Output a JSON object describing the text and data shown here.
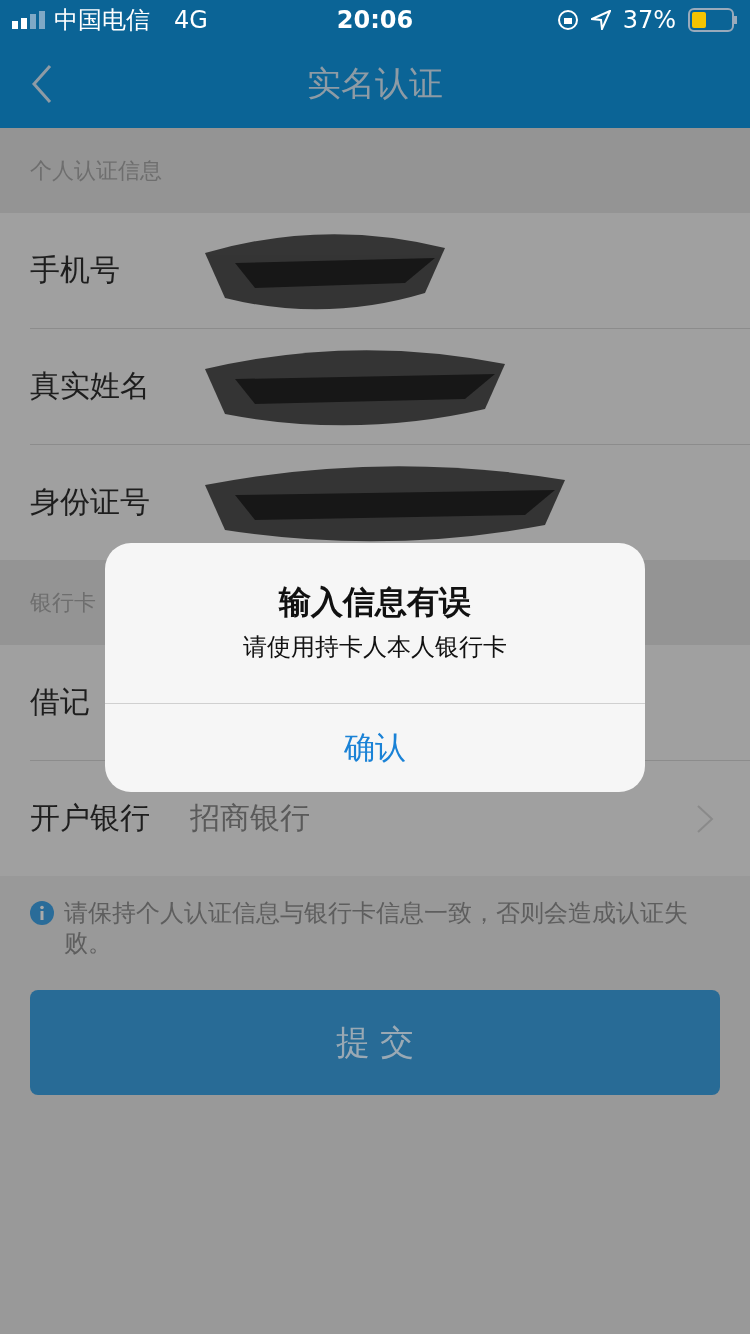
{
  "status_bar": {
    "carrier": "中国电信",
    "network": "4G",
    "time": "20:06",
    "battery": "37%"
  },
  "nav": {
    "title": "实名认证"
  },
  "sections": [
    {
      "header": "个人认证信息",
      "rows": [
        {
          "kind": "text",
          "label": "手机号",
          "redacted": true
        },
        {
          "kind": "text",
          "label": "真实姓名",
          "redacted": true
        },
        {
          "kind": "text",
          "label": "身份证号",
          "redacted": true
        }
      ]
    },
    {
      "header": "银行卡",
      "rows": [
        {
          "kind": "text",
          "label": "借记",
          "redacted": false
        },
        {
          "kind": "select",
          "label": "开户银行",
          "value": "招商银行",
          "redacted": false
        }
      ]
    }
  ],
  "note": "请保持个人认证信息与银行卡信息一致，否则会造成认证失败。",
  "submit": {
    "label": "提 交"
  },
  "dialog": {
    "title": "输入信息有误",
    "message": "请使用持卡人本人银行卡",
    "button": "确认"
  }
}
